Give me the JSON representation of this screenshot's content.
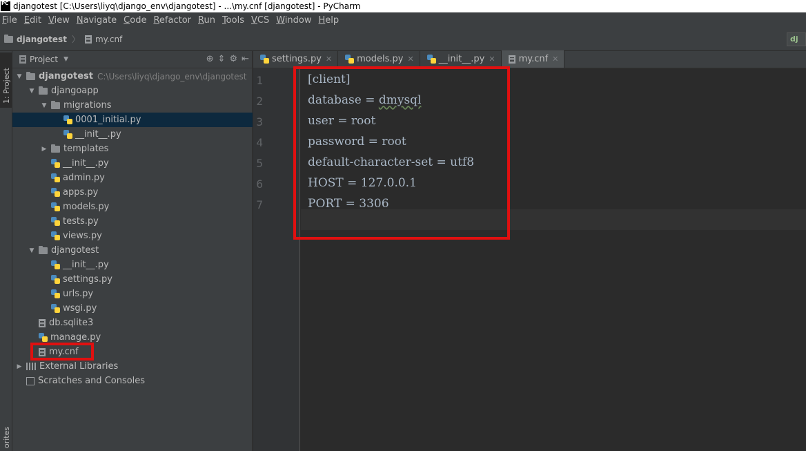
{
  "window": {
    "title": "djangotest [C:\\Users\\liyq\\django_env\\djangotest] - ...\\my.cnf [djangotest] - PyCharm",
    "app_logo_text": "PC"
  },
  "menu": [
    "File",
    "Edit",
    "View",
    "Navigate",
    "Code",
    "Refactor",
    "Run",
    "Tools",
    "VCS",
    "Window",
    "Help"
  ],
  "navbar": {
    "project": "djangotest",
    "file": "my.cnf",
    "django_badge": "dj"
  },
  "side_tabs": {
    "project": "1: Project",
    "favorites": "orites"
  },
  "project_panel": {
    "view_selector": "Project",
    "tree": [
      {
        "label": "djangotest",
        "hint": "C:\\Users\\liyq\\django_env\\djangotest",
        "type": "folder",
        "expanded": true,
        "depth": 0
      },
      {
        "label": "djangoapp",
        "type": "folder",
        "expanded": true,
        "depth": 1
      },
      {
        "label": "migrations",
        "type": "folder",
        "expanded": true,
        "depth": 2
      },
      {
        "label": "0001_initial.py",
        "type": "py",
        "depth": 3,
        "selected": true
      },
      {
        "label": "__init__.py",
        "type": "py",
        "depth": 3
      },
      {
        "label": "templates",
        "type": "folder",
        "expanded": false,
        "depth": 2
      },
      {
        "label": "__init__.py",
        "type": "py",
        "depth": 2
      },
      {
        "label": "admin.py",
        "type": "py",
        "depth": 2
      },
      {
        "label": "apps.py",
        "type": "py",
        "depth": 2
      },
      {
        "label": "models.py",
        "type": "py",
        "depth": 2
      },
      {
        "label": "tests.py",
        "type": "py",
        "depth": 2
      },
      {
        "label": "views.py",
        "type": "py",
        "depth": 2
      },
      {
        "label": "djangotest",
        "type": "folder",
        "expanded": true,
        "depth": 1
      },
      {
        "label": "__init__.py",
        "type": "py",
        "depth": 2
      },
      {
        "label": "settings.py",
        "type": "py",
        "depth": 2
      },
      {
        "label": "urls.py",
        "type": "py",
        "depth": 2
      },
      {
        "label": "wsgi.py",
        "type": "py",
        "depth": 2
      },
      {
        "label": "db.sqlite3",
        "type": "db",
        "depth": 1
      },
      {
        "label": "manage.py",
        "type": "py",
        "depth": 1
      },
      {
        "label": "my.cnf",
        "type": "file",
        "depth": 1
      },
      {
        "label": "External Libraries",
        "type": "libs",
        "expanded": false,
        "depth": 0
      },
      {
        "label": "Scratches and Consoles",
        "type": "scratch",
        "depth": 0
      }
    ]
  },
  "editor": {
    "tabs": [
      {
        "label": "settings.py",
        "type": "py",
        "active": false
      },
      {
        "label": "models.py",
        "type": "py",
        "active": false
      },
      {
        "label": "__init__.py",
        "type": "py",
        "active": false
      },
      {
        "label": "my.cnf",
        "type": "file",
        "active": true
      }
    ],
    "lines": [
      {
        "num": "1",
        "text": "[client]"
      },
      {
        "num": "2",
        "text": "database = ",
        "squiggle": "dmysql"
      },
      {
        "num": "3",
        "text": "user = root"
      },
      {
        "num": "4",
        "text": "password = root"
      },
      {
        "num": "5",
        "text": "default-character-set = utf8"
      },
      {
        "num": "6",
        "text": "HOST = 127.0.0.1"
      },
      {
        "num": "7",
        "text": "PORT = 3306"
      }
    ]
  },
  "colors": {
    "annotation": "#e01010",
    "background": "#2b2b2b",
    "panel": "#3c3f41",
    "selection": "#0d293e"
  }
}
